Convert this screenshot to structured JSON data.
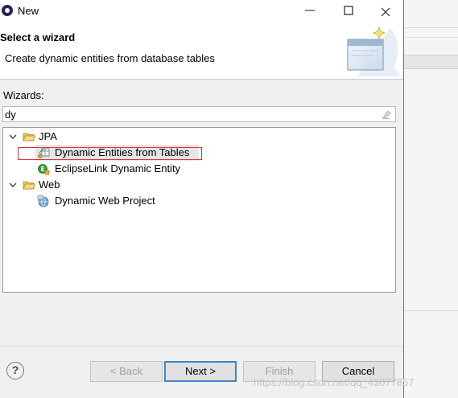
{
  "window": {
    "title": "New",
    "minimize_glyph": "—",
    "maximize_glyph": "☐",
    "close_glyph": "✕"
  },
  "banner": {
    "title": "Select a wizard",
    "description": "Create dynamic entities from database tables",
    "image": "wizard-banner-icon"
  },
  "wizards": {
    "label": "Wizards:",
    "filter_value": "dy",
    "tree": [
      {
        "label": "JPA",
        "expanded": true,
        "icon": "folder-open-icon",
        "children": [
          {
            "label": "Dynamic Entities from Tables",
            "icon": "entities-from-tables-icon",
            "selected": true
          },
          {
            "label": "EclipseLink Dynamic Entity",
            "icon": "eclipselink-entity-icon"
          }
        ]
      },
      {
        "label": "Web",
        "expanded": true,
        "icon": "folder-open-icon",
        "children": [
          {
            "label": "Dynamic Web Project",
            "icon": "web-project-icon"
          }
        ]
      }
    ]
  },
  "buttons": {
    "help": "?",
    "back": "< Back",
    "next": "Next >",
    "finish": "Finish",
    "cancel": "Cancel"
  },
  "watermark": "https://blog.csdn.net/qq_43077857",
  "colors": {
    "highlight_border": "#e03030",
    "default_button_border": "#3d85c6",
    "dialog_border": "#3c7fb1"
  }
}
